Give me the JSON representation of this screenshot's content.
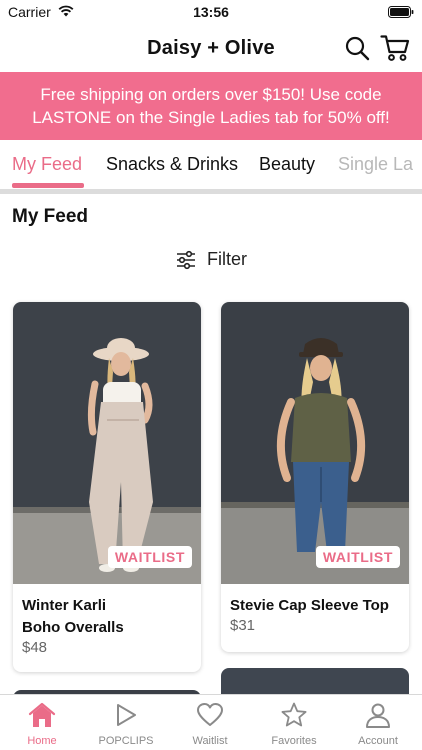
{
  "status_bar": {
    "carrier": "Carrier",
    "time": "13:56"
  },
  "header": {
    "title": "Daisy + Olive",
    "icons": [
      "search-icon",
      "cart-icon"
    ]
  },
  "promo": {
    "line1": "Free shipping on orders over $150! Use code",
    "line2": "LASTONE on the Single Ladies tab for 50% off!",
    "background": "#f16d8e"
  },
  "category_tabs": [
    {
      "label": "My Feed",
      "active": true
    },
    {
      "label": "Snacks & Drinks",
      "active": false
    },
    {
      "label": "Beauty",
      "active": false
    },
    {
      "label": "Single La",
      "active": false
    }
  ],
  "feed": {
    "heading": "My Feed",
    "filter_label": "Filter"
  },
  "products": [
    {
      "name_line1": "Winter Karli",
      "name_line2": "Boho Overalls",
      "price": "$48",
      "badge": "WAITLIST"
    },
    {
      "name_line1": "Stevie Cap Sleeve Top",
      "price": "$31",
      "badge": "WAITLIST"
    }
  ],
  "bottom_nav": [
    {
      "label": "Home",
      "icon": "home-icon",
      "active": true
    },
    {
      "label": "POPCLIPS",
      "icon": "play-icon",
      "active": false
    },
    {
      "label": "Waitlist",
      "icon": "heart-icon",
      "active": false
    },
    {
      "label": "Favorites",
      "icon": "star-icon",
      "active": false
    },
    {
      "label": "Account",
      "icon": "person-icon",
      "active": false
    }
  ],
  "colors": {
    "accent": "#ea6c88",
    "inactive": "#8a8a8a"
  }
}
